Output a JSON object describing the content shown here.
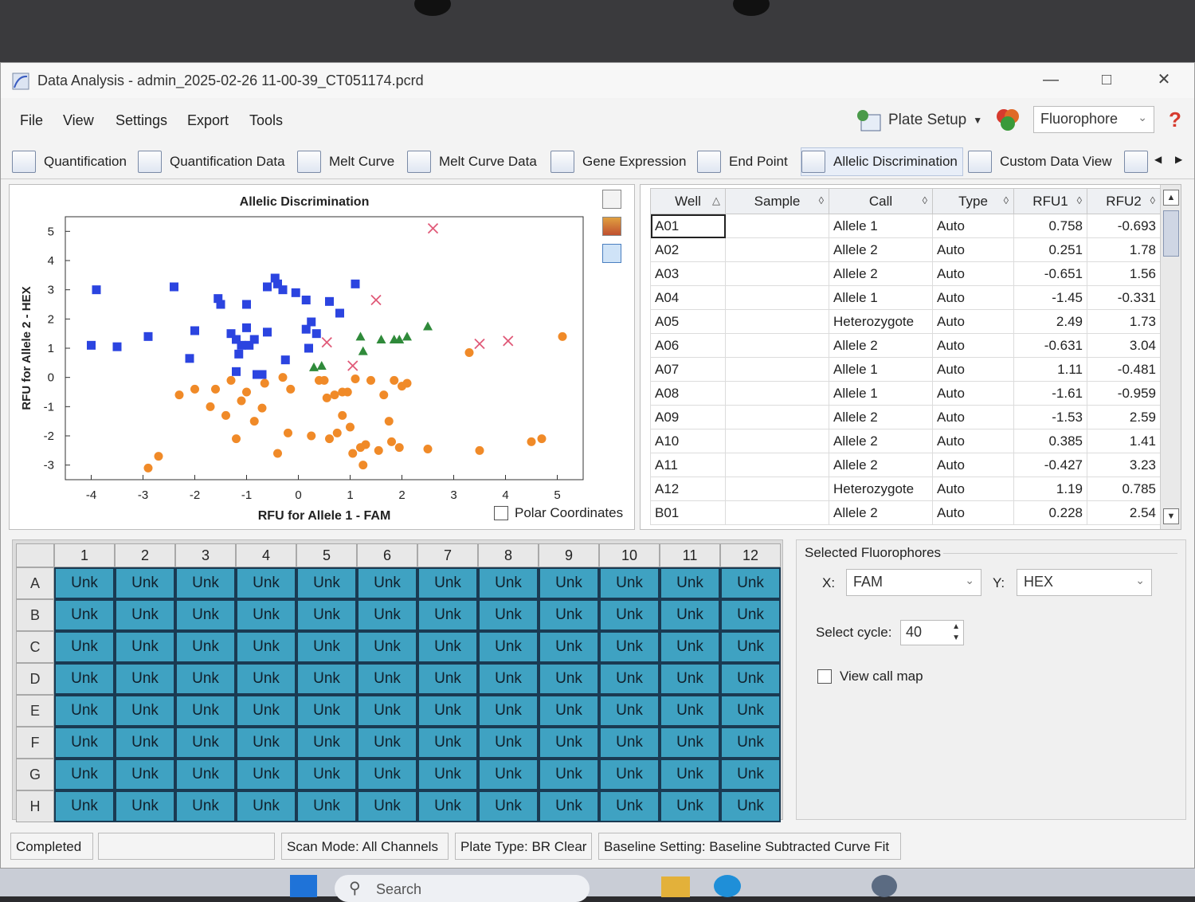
{
  "window": {
    "title": "Data Analysis - admin_2025-02-26 11-00-39_CT051174.pcrd"
  },
  "menu": [
    "File",
    "View",
    "Settings",
    "Export",
    "Tools"
  ],
  "toolbar": {
    "plate_setup": "Plate Setup",
    "fluorophore_select": "Fluorophore",
    "help": "?"
  },
  "tabs": [
    "Quantification",
    "Quantification Data",
    "Melt Curve",
    "Melt Curve Data",
    "Gene Expression",
    "End Point",
    "Allelic Discrimination",
    "Custom Data View"
  ],
  "chart_data": {
    "type": "scatter",
    "title": "Allelic Discrimination",
    "xlabel": "RFU for Allele 1 - FAM",
    "ylabel": "RFU for Allele 2 - HEX",
    "xlim": [
      -4.5,
      5.5
    ],
    "ylim": [
      -3.5,
      5.5
    ],
    "xticks": [
      -4,
      -3,
      -2,
      -1,
      0,
      1,
      2,
      3,
      4,
      5
    ],
    "yticks": [
      -3,
      -2,
      -1,
      0,
      1,
      2,
      3,
      4,
      5
    ],
    "grid": false,
    "colors": {
      "allele2": "#2b44e0",
      "allele1": "#f08a28",
      "het": "#2f8a3a",
      "none": "#e05a78"
    },
    "series": [
      {
        "marker": "square",
        "color": "#2b44e0",
        "points": [
          [
            -3.9,
            3.0
          ],
          [
            -4.0,
            1.1
          ],
          [
            -3.5,
            1.05
          ],
          [
            -2.9,
            1.4
          ],
          [
            -2.4,
            3.1
          ],
          [
            -2.1,
            0.65
          ],
          [
            -2.0,
            1.6
          ],
          [
            -1.55,
            2.7
          ],
          [
            -1.5,
            2.5
          ],
          [
            -1.3,
            1.5
          ],
          [
            -1.2,
            1.3
          ],
          [
            -1.1,
            1.1
          ],
          [
            -1.15,
            0.8
          ],
          [
            -1.2,
            0.2
          ],
          [
            -1.0,
            1.7
          ],
          [
            -1.0,
            2.5
          ],
          [
            -0.95,
            1.1
          ],
          [
            -0.85,
            1.3
          ],
          [
            -0.8,
            0.1
          ],
          [
            -0.7,
            0.1
          ],
          [
            -0.6,
            1.55
          ],
          [
            -0.6,
            3.1
          ],
          [
            -0.45,
            3.4
          ],
          [
            -0.4,
            3.2
          ],
          [
            -0.3,
            3.0
          ],
          [
            -0.25,
            0.6
          ],
          [
            -0.05,
            2.9
          ],
          [
            0.15,
            2.65
          ],
          [
            0.15,
            1.65
          ],
          [
            0.2,
            1.0
          ],
          [
            0.25,
            1.9
          ],
          [
            0.35,
            1.5
          ],
          [
            0.6,
            2.6
          ],
          [
            0.8,
            2.2
          ],
          [
            1.1,
            3.2
          ]
        ]
      },
      {
        "marker": "circle",
        "color": "#f08a28",
        "points": [
          [
            -2.9,
            -3.1
          ],
          [
            -2.7,
            -2.7
          ],
          [
            -2.3,
            -0.6
          ],
          [
            -2.0,
            -0.4
          ],
          [
            -1.7,
            -1.0
          ],
          [
            -1.6,
            -0.4
          ],
          [
            -1.4,
            -1.3
          ],
          [
            -1.3,
            -0.1
          ],
          [
            -1.2,
            -2.1
          ],
          [
            -1.1,
            -0.8
          ],
          [
            -1.0,
            -0.5
          ],
          [
            -0.85,
            -1.5
          ],
          [
            -0.7,
            -1.05
          ],
          [
            -0.65,
            -0.2
          ],
          [
            -0.4,
            -2.6
          ],
          [
            -0.3,
            0.0
          ],
          [
            -0.2,
            -1.9
          ],
          [
            -0.15,
            -0.4
          ],
          [
            0.25,
            -2.0
          ],
          [
            0.4,
            -0.1
          ],
          [
            0.5,
            -0.1
          ],
          [
            0.55,
            -0.7
          ],
          [
            0.6,
            -2.1
          ],
          [
            0.7,
            -0.6
          ],
          [
            0.75,
            -1.9
          ],
          [
            0.85,
            -0.5
          ],
          [
            0.85,
            -1.3
          ],
          [
            0.95,
            -0.5
          ],
          [
            1.0,
            -1.7
          ],
          [
            1.05,
            -2.6
          ],
          [
            1.1,
            -0.05
          ],
          [
            1.2,
            -2.4
          ],
          [
            1.25,
            -3.0
          ],
          [
            1.3,
            -2.3
          ],
          [
            1.4,
            -0.1
          ],
          [
            1.55,
            -2.5
          ],
          [
            1.65,
            -0.6
          ],
          [
            1.75,
            -1.5
          ],
          [
            1.8,
            -2.2
          ],
          [
            1.85,
            -0.1
          ],
          [
            1.95,
            -2.4
          ],
          [
            2.0,
            -0.3
          ],
          [
            2.1,
            -0.2
          ],
          [
            2.5,
            -2.45
          ],
          [
            3.3,
            0.85
          ],
          [
            3.5,
            -2.5
          ],
          [
            4.5,
            -2.2
          ],
          [
            4.7,
            -2.1
          ],
          [
            5.1,
            1.4
          ]
        ]
      },
      {
        "marker": "triangle",
        "color": "#2f8a3a",
        "points": [
          [
            0.3,
            0.35
          ],
          [
            0.45,
            0.4
          ],
          [
            1.2,
            1.4
          ],
          [
            1.25,
            0.9
          ],
          [
            1.6,
            1.3
          ],
          [
            1.85,
            1.3
          ],
          [
            1.95,
            1.3
          ],
          [
            2.1,
            1.4
          ],
          [
            2.5,
            1.75
          ]
        ]
      },
      {
        "marker": "cross",
        "color": "#e05a78",
        "points": [
          [
            2.6,
            5.1
          ],
          [
            1.5,
            2.65
          ],
          [
            0.55,
            1.2
          ],
          [
            1.05,
            0.4
          ],
          [
            3.5,
            1.15
          ],
          [
            4.05,
            1.25
          ]
        ]
      }
    ]
  },
  "plot_panel": {
    "polar_coordinates": "Polar Coordinates"
  },
  "grid": {
    "columns": [
      "Well",
      "Sample",
      "Call",
      "Type",
      "RFU1",
      "RFU2"
    ],
    "rows": [
      [
        "A01",
        "",
        "Allele 1",
        "Auto",
        "0.758",
        "-0.693"
      ],
      [
        "A02",
        "",
        "Allele 2",
        "Auto",
        "0.251",
        "1.78"
      ],
      [
        "A03",
        "",
        "Allele 2",
        "Auto",
        "-0.651",
        "1.56"
      ],
      [
        "A04",
        "",
        "Allele 1",
        "Auto",
        "-1.45",
        "-0.331"
      ],
      [
        "A05",
        "",
        "Heterozygote",
        "Auto",
        "2.49",
        "1.73"
      ],
      [
        "A06",
        "",
        "Allele 2",
        "Auto",
        "-0.631",
        "3.04"
      ],
      [
        "A07",
        "",
        "Allele 1",
        "Auto",
        "1.11",
        "-0.481"
      ],
      [
        "A08",
        "",
        "Allele 1",
        "Auto",
        "-1.61",
        "-0.959"
      ],
      [
        "A09",
        "",
        "Allele 2",
        "Auto",
        "-1.53",
        "2.59"
      ],
      [
        "A10",
        "",
        "Allele 2",
        "Auto",
        "0.385",
        "1.41"
      ],
      [
        "A11",
        "",
        "Allele 2",
        "Auto",
        "-0.427",
        "3.23"
      ],
      [
        "A12",
        "",
        "Heterozygote",
        "Auto",
        "1.19",
        "0.785"
      ],
      [
        "B01",
        "",
        "Allele 2",
        "Auto",
        "0.228",
        "2.54"
      ]
    ]
  },
  "plate": {
    "columns": [
      "1",
      "2",
      "3",
      "4",
      "5",
      "6",
      "7",
      "8",
      "9",
      "10",
      "11",
      "12"
    ],
    "rows": [
      "A",
      "B",
      "C",
      "D",
      "E",
      "F",
      "G",
      "H"
    ],
    "well_label": "Unk",
    "well_color": "#3fa2c2"
  },
  "fluorophores": {
    "title": "Selected Fluorophores",
    "x_label": "X:",
    "x_value": "FAM",
    "y_label": "Y:",
    "y_value": "HEX",
    "cycle_label": "Select cycle:",
    "cycle_value": "40",
    "view_call_map": "View call map"
  },
  "status": {
    "state": "Completed",
    "scan_mode": "Scan Mode: All Channels",
    "plate_type": "Plate Type: BR Clear",
    "baseline": "Baseline Setting: Baseline Subtracted Curve Fit"
  },
  "taskbar": {
    "search_placeholder": "Search"
  }
}
